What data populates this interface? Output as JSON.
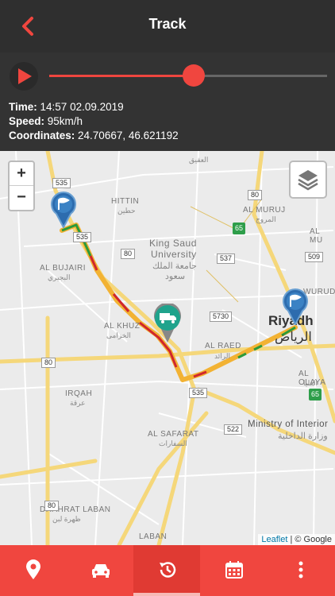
{
  "header": {
    "title": "Track",
    "back_icon": "chevron-left-icon",
    "accent_color": "#f0463f"
  },
  "playback": {
    "play_icon": "play-icon",
    "progress": 0.52,
    "time_label": "Time",
    "time_value": "14:57 02.09.2019",
    "speed_label": "Speed",
    "speed_value": "95km/h",
    "coords_label": "Coordinates",
    "coords_value": "24.70667, 46.621192"
  },
  "map": {
    "zoom_in": "+",
    "zoom_out": "−",
    "layers_icon": "layers-icon",
    "labels": {
      "hittin": "HITTIN",
      "hittin_ar": "حطين",
      "aqiq_ar": "العقيق",
      "al_muruj": "AL MURUJ",
      "al_muruj_ar": "المروج",
      "al_mu": "AL MU",
      "ksu1": "King Saud",
      "ksu2": "University",
      "ksu_ar1": "جامعة الملك",
      "ksu_ar2": "سعود",
      "al_bujairi": "AL BUJAIRI",
      "al_bujairi_ar": "البجيري",
      "al_khuz": "AL KHUZ",
      "al_khuz_ar": "الخزامى",
      "al_raed": "AL RAED",
      "al_raed_ar": "الرائد",
      "wurud": "WURUD",
      "al_olaya": "AL OLAYA",
      "al_olaya_ar": "العليا",
      "riyadh": "Riyadh",
      "riyadh_ar": "الرياض",
      "irqah": "IRQAH",
      "irqah_ar": "عرقة",
      "al_safarat": "AL SAFARAT",
      "al_safarat_ar": "السفارات",
      "ministry": "Ministry of Interior",
      "ministry_ar": "وزارة الداخلية",
      "dhahrat": "DHAHRAT LABAN",
      "dhahrat_ar": "ظهرة لبن",
      "laban": "LABAN"
    },
    "shields": {
      "r535a": "535",
      "r535b": "535",
      "r535c": "535",
      "r80a": "80",
      "r80b": "80",
      "r80c": "80",
      "r80d": "80",
      "r5730": "5730",
      "r537": "537",
      "r509": "509",
      "r65a": "65",
      "r65b": "65",
      "r522": "522"
    },
    "start_marker_icon": "flag-marker-icon",
    "end_marker_icon": "flag-marker-icon",
    "vehicle_marker_icon": "truck-marker-icon",
    "attribution_link": "Leaflet",
    "attribution_text": " | © Google"
  },
  "bottom_nav": [
    {
      "icon": "location-pin-icon"
    },
    {
      "icon": "car-icon"
    },
    {
      "icon": "history-icon",
      "active": true
    },
    {
      "icon": "calendar-icon"
    },
    {
      "icon": "more-vertical-icon"
    }
  ]
}
